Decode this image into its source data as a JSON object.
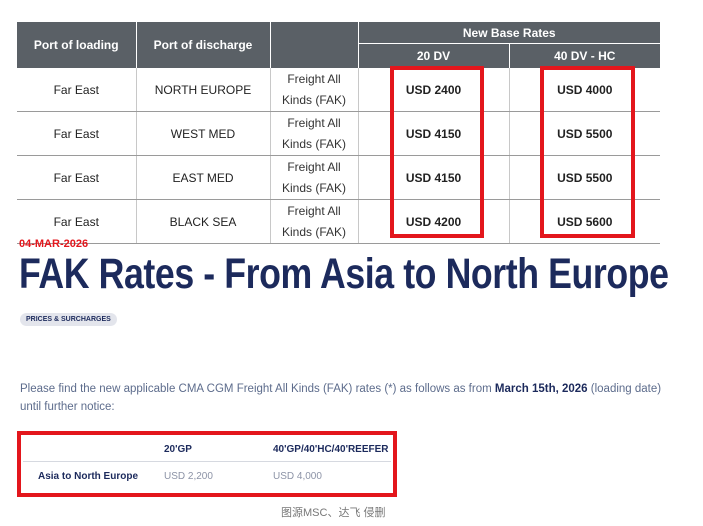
{
  "top_table": {
    "headers": {
      "port_of_loading": "Port of loading",
      "port_of_discharge": "Port of discharge",
      "new_base_rates": "New Base Rates",
      "col_20": "20 DV",
      "col_40": "40 DV - HC"
    },
    "rows": [
      {
        "loading": "Far East",
        "discharge": "NORTH EUROPE",
        "type_line1": "Freight All",
        "type_line2": "Kinds (FAK)",
        "rate_20": "USD 2400",
        "rate_40": "USD 4000"
      },
      {
        "loading": "Far East",
        "discharge": "WEST MED",
        "type_line1": "Freight All",
        "type_line2": "Kinds (FAK)",
        "rate_20": "USD 4150",
        "rate_40": "USD 5500"
      },
      {
        "loading": "Far East",
        "discharge": "EAST MED",
        "type_line1": "Freight All",
        "type_line2": "Kinds (FAK)",
        "rate_20": "USD 4150",
        "rate_40": "USD 5500"
      },
      {
        "loading": "Far East",
        "discharge": "BLACK SEA",
        "type_line1": "Freight All",
        "type_line2": "Kinds (FAK)",
        "rate_20": "USD 4200",
        "rate_40": "USD 5600"
      }
    ]
  },
  "article": {
    "date": "04-MAR-2026",
    "title": "FAK Rates - From Asia to North Europe",
    "tag": "PRICES & SURCHARGES",
    "intro_before": "Please find the new applicable CMA CGM Freight All Kinds (FAK) rates (*) as follows as from ",
    "intro_bold": "March 15th, 2026",
    "intro_after": " (loading date) until further notice:"
  },
  "bottom_table": {
    "col1": "",
    "col2": "20'GP",
    "col3": "40'GP/40'HC/40'REEFER",
    "row_lane": "Asia to North Europe",
    "row_20": "USD 2,200",
    "row_40": "USD 4,000"
  },
  "caption": "图源MSC、达飞 侵删",
  "colors": {
    "header_bg": "#5a6066",
    "highlight_red": "#e3161c",
    "title_navy": "#1c2a5c"
  }
}
